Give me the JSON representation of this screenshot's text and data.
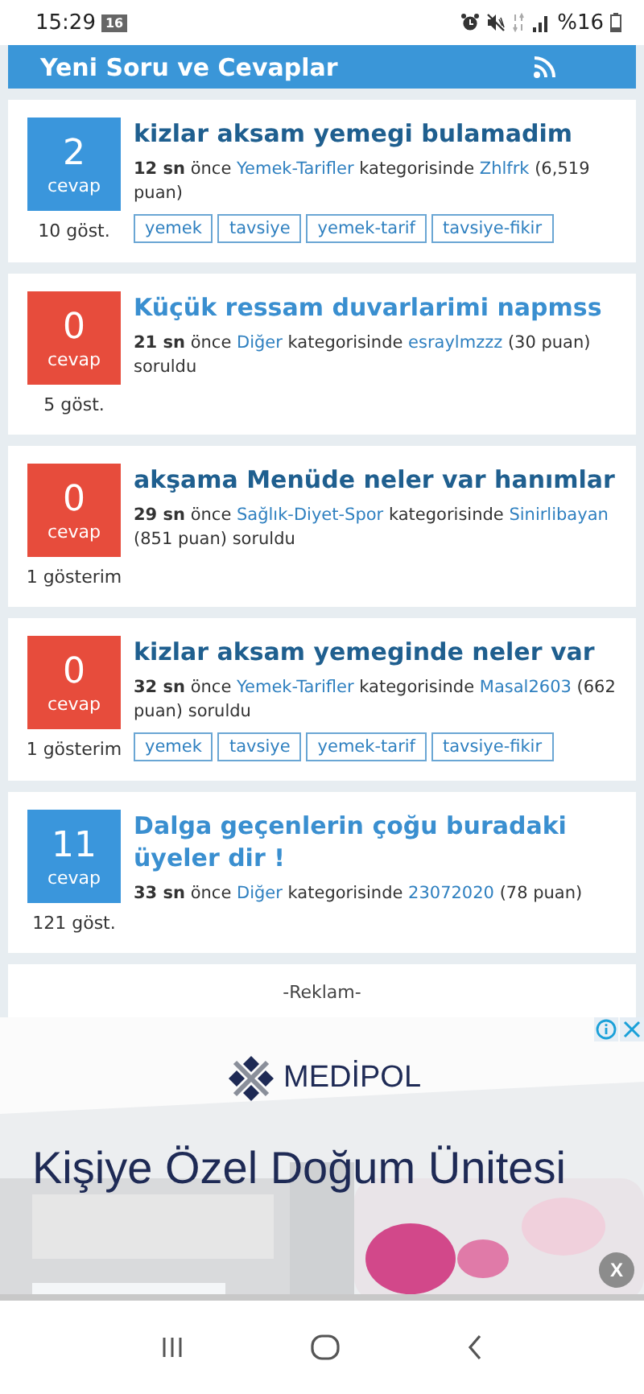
{
  "status_bar": {
    "time": "15:29",
    "badge": "16",
    "battery": "%16"
  },
  "header": {
    "title": "Yeni Soru ve Cevaplar"
  },
  "questions": [
    {
      "count": "2",
      "count_label": "cevap",
      "color": "#3a96dc",
      "views": "10 göst.",
      "title": "kizlar aksam yemegi bulamadim",
      "visited": true,
      "age": "12 sn",
      "age_suffix": "önce",
      "category": "Yemek-Tarifler",
      "category_suffix": "kategorisinde",
      "user": "Zhlfrk",
      "points": "(6,519 puan)",
      "tags": [
        "yemek",
        "tavsiye",
        "yemek-tarif",
        "tavsiye-fikir"
      ]
    },
    {
      "count": "0",
      "count_label": "cevap",
      "color": "#e74c3c",
      "views": "5 göst.",
      "title": "Küçük ressam duvarlarimi napmss",
      "visited": false,
      "age": "21 sn",
      "age_suffix": "önce",
      "category": "Diğer",
      "category_suffix": "kategorisinde",
      "user": "esraylmzzz",
      "points": "(30 puan)",
      "tail": "soruldu"
    },
    {
      "count": "0",
      "count_label": "cevap",
      "color": "#e74c3c",
      "views": "1 gösterim",
      "title": "akşama Menüde neler var hanımlar",
      "visited": true,
      "age": "29 sn",
      "age_suffix": "önce",
      "category": "Sağlık-Diyet-Spor",
      "category_suffix": "kategorisinde",
      "user": "Sinirlibayan",
      "points": "(851 puan)",
      "tail": "soruldu"
    },
    {
      "count": "0",
      "count_label": "cevap",
      "color": "#e74c3c",
      "views": "1 gösterim",
      "title": "kizlar aksam yemeginde neler var",
      "visited": true,
      "age": "32 sn",
      "age_suffix": "önce",
      "category": "Yemek-Tarifler",
      "category_suffix": "kategorisinde",
      "user": "Masal2603",
      "points": "(662 puan)",
      "tail": "soruldu",
      "tags": [
        "yemek",
        "tavsiye",
        "yemek-tarif",
        "tavsiye-fikir"
      ]
    },
    {
      "count": "11",
      "count_label": "cevap",
      "color": "#3a96dc",
      "views": "121 göst.",
      "title": "Dalga geçenlerin çoğu buradaki üyeler dir !",
      "visited": false,
      "age": "33 sn",
      "age_suffix": "önce",
      "category": "Diğer",
      "category_suffix": "kategorisinde",
      "user": "23072020",
      "points": "(78 puan)"
    }
  ],
  "ad_label": "-Reklam-",
  "ad": {
    "brand": "MEDİPOL",
    "headline": "Kişiye Özel Doğum Ünitesi",
    "close": "X",
    "kind": "picture"
  }
}
